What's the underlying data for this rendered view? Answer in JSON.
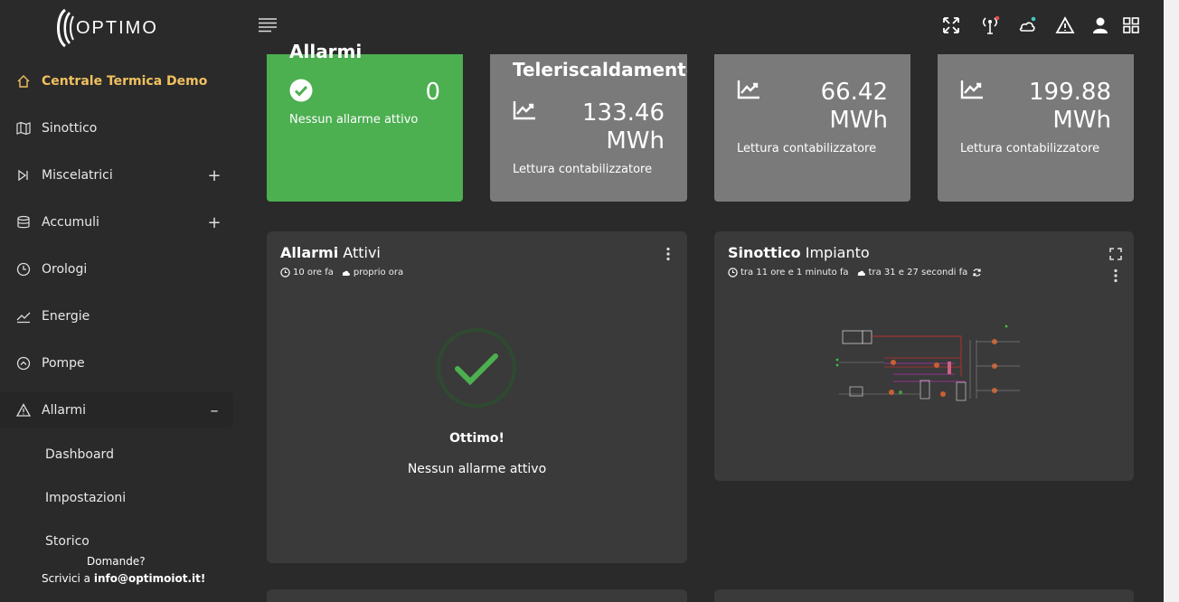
{
  "brand": {
    "name": "OPTIMO"
  },
  "sidebar": {
    "items": [
      {
        "label": "Centrale Termica Demo",
        "icon": "home-icon",
        "active": true
      },
      {
        "label": "Sinottico",
        "icon": "map-icon"
      },
      {
        "label": "Miscelatrici",
        "icon": "skip-icon",
        "toggle": "+"
      },
      {
        "label": "Accumuli",
        "icon": "database-icon",
        "toggle": "+"
      },
      {
        "label": "Orologi",
        "icon": "clock-icon"
      },
      {
        "label": "Energie",
        "icon": "trend-icon"
      },
      {
        "label": "Pompe",
        "icon": "pump-icon"
      },
      {
        "label": "Allarmi",
        "icon": "alert-icon",
        "toggle": "–"
      }
    ],
    "subitems": [
      "Dashboard",
      "Impostazioni",
      "Storico"
    ],
    "footer": {
      "question": "Domande?",
      "write_prefix": "Scrivici a ",
      "email": "info@optimoiot.it!"
    }
  },
  "topbar": {
    "icons": [
      "fullscreen-icon",
      "antenna-icon",
      "cloud-status-icon",
      "alert-icon",
      "user-icon",
      "apps-grid-icon"
    ]
  },
  "stats": [
    {
      "title": "Allarmi",
      "value": "0",
      "subtitle": "Nessun allarme attivo",
      "color": "#4caf50"
    },
    {
      "title": "Teleriscaldamento",
      "value_number": "133.46",
      "value_unit": "MWh",
      "subtitle": "Lettura contabilizzatore"
    },
    {
      "value_number": "66.42",
      "value_unit": "MWh",
      "subtitle": "Lettura contabilizzatore"
    },
    {
      "value_number": "199.88",
      "value_unit": "MWh",
      "subtitle": "Lettura contabilizzatore"
    }
  ],
  "alarms_panel": {
    "title_bold": "Allarmi",
    "title_rest": " Attivi",
    "meta_time": "10 ore fa",
    "meta_cloud": "proprio ora",
    "ok_title": "Ottimo!",
    "ok_sub": "Nessun allarme attivo"
  },
  "synoptic_panel": {
    "title_bold": "Sinottico",
    "title_rest": " Impianto",
    "meta_time": "tra 11 ore e 1 minuto fa",
    "meta_cloud": "tra 31 e 27 secondi fa"
  },
  "colors": {
    "accent": "#f0c060",
    "success": "#4caf50",
    "card_grey": "#7a7a7a",
    "panel": "#3a3a3a"
  }
}
